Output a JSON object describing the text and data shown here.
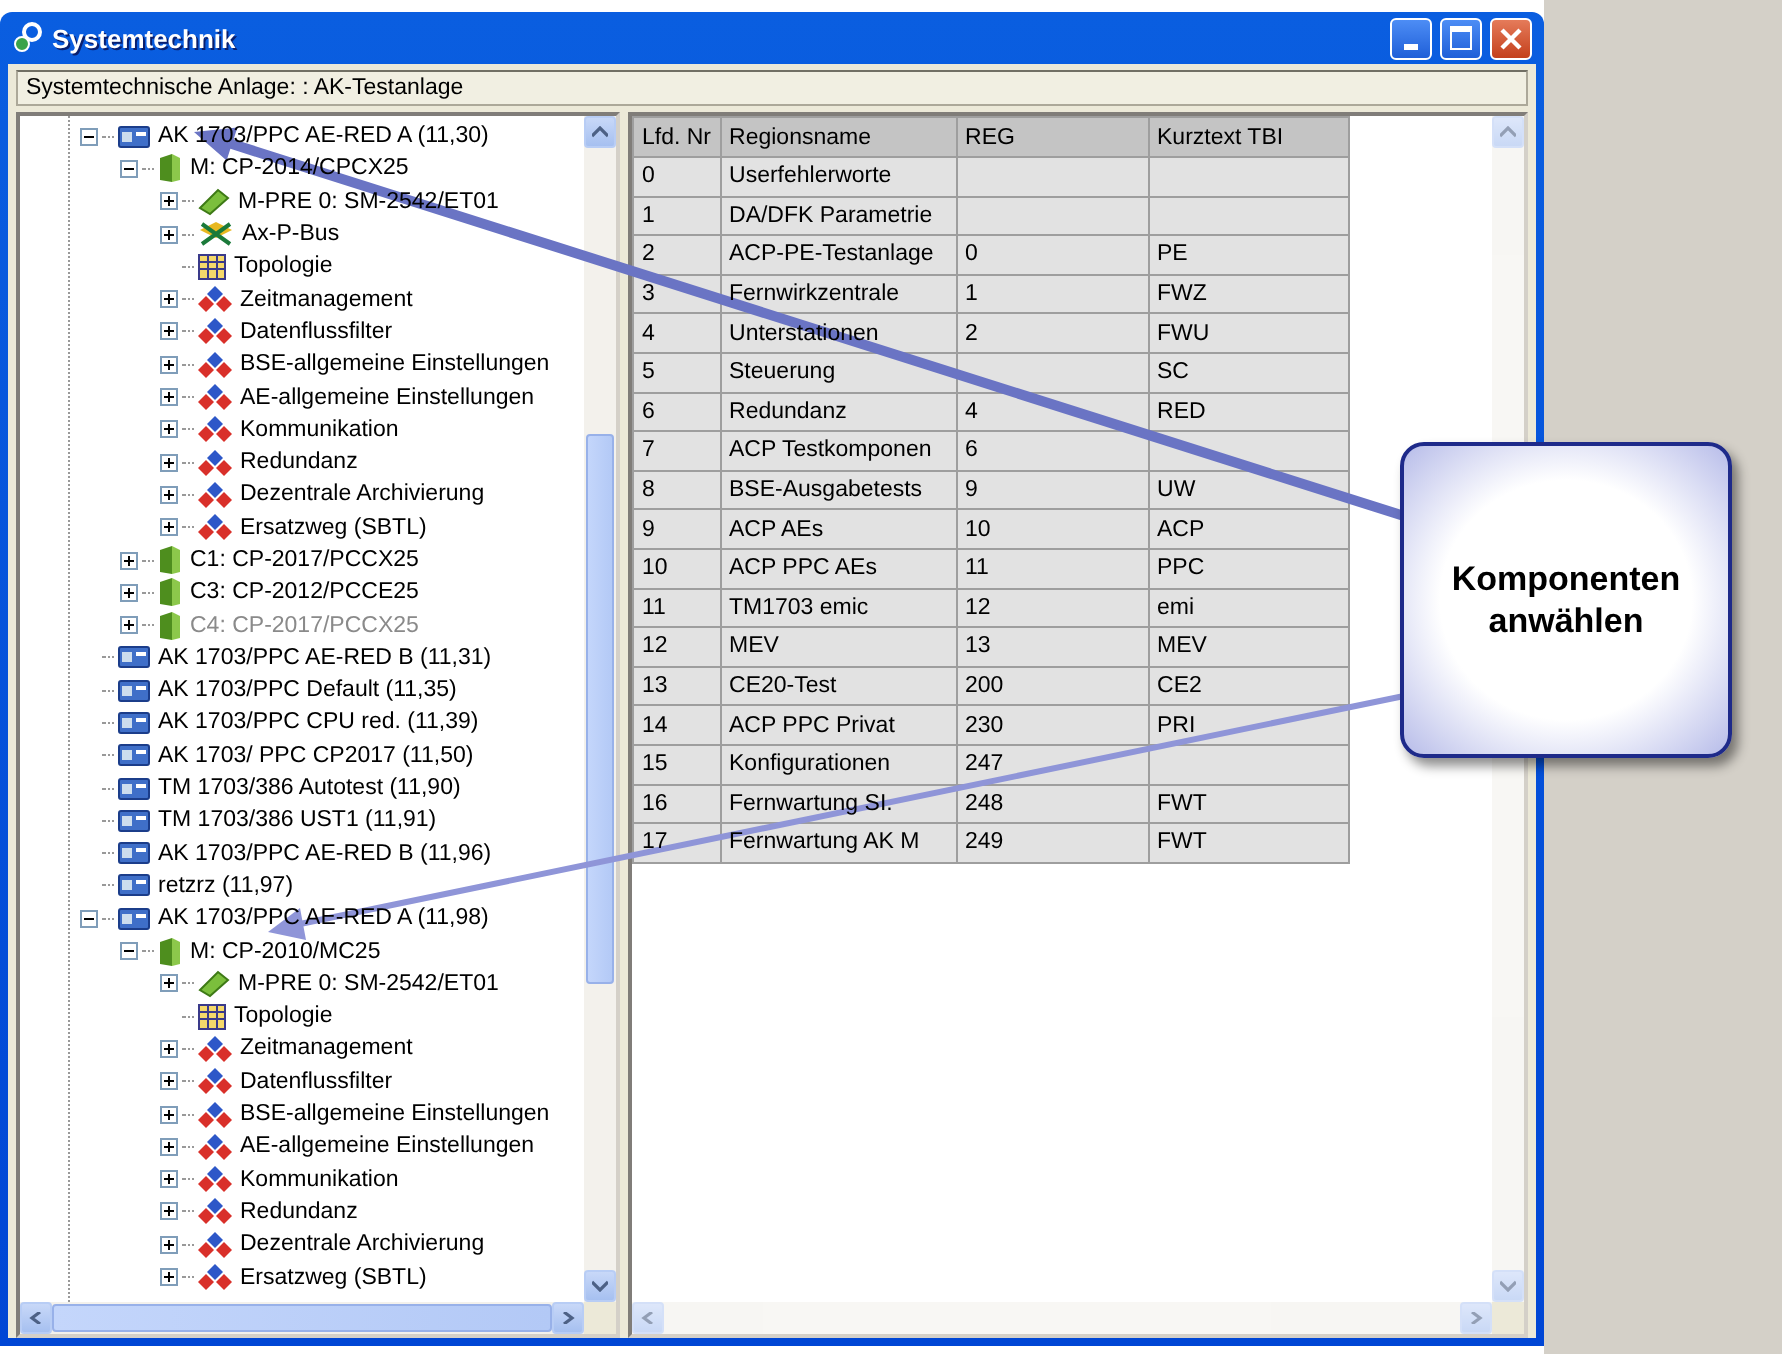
{
  "window": {
    "title": "Systemtechnik"
  },
  "address_bar": "Systemtechnische Anlage: : AK-Testanlage",
  "tree": [
    {
      "label": "AK 1703/PPC AE-RED A (11,30)",
      "kind": "station",
      "expanded": true,
      "children": [
        {
          "label": "M: CP-2014/CPCX25",
          "kind": "module",
          "expanded": true,
          "children": [
            {
              "label": "M-PRE 0: SM-2542/ET01",
              "kind": "chip",
              "expanded": false
            },
            {
              "label": "Ax-P-Bus",
              "kind": "bus",
              "expanded": false
            },
            {
              "label": "Topologie",
              "kind": "table"
            },
            {
              "label": "Zeitmanagement",
              "kind": "setting",
              "expanded": false
            },
            {
              "label": "Datenflussfilter",
              "kind": "setting",
              "expanded": false
            },
            {
              "label": "BSE-allgemeine Einstellungen",
              "kind": "setting",
              "expanded": false
            },
            {
              "label": "AE-allgemeine Einstellungen",
              "kind": "setting",
              "expanded": false
            },
            {
              "label": "Kommunikation",
              "kind": "setting",
              "expanded": false
            },
            {
              "label": "Redundanz",
              "kind": "setting",
              "expanded": false
            },
            {
              "label": "Dezentrale Archivierung",
              "kind": "setting",
              "expanded": false
            },
            {
              "label": "Ersatzweg (SBTL)",
              "kind": "setting",
              "expanded": false
            }
          ]
        },
        {
          "label": "C1: CP-2017/PCCX25",
          "kind": "module",
          "expanded": false
        },
        {
          "label": "C3: CP-2012/PCCE25",
          "kind": "module",
          "expanded": false
        },
        {
          "label": "C4: CP-2017/PCCX25",
          "kind": "module",
          "expanded": false,
          "disabled": true
        }
      ]
    },
    {
      "label": "AK 1703/PPC AE-RED B (11,31)",
      "kind": "station"
    },
    {
      "label": "AK 1703/PPC Default (11,35)",
      "kind": "station"
    },
    {
      "label": "AK 1703/PPC CPU red. (11,39)",
      "kind": "station"
    },
    {
      "label": "AK 1703/ PPC CP2017 (11,50)",
      "kind": "station"
    },
    {
      "label": "TM 1703/386 Autotest (11,90)",
      "kind": "station"
    },
    {
      "label": "TM 1703/386 UST1 (11,91)",
      "kind": "station"
    },
    {
      "label": "AK 1703/PPC AE-RED B (11,96)",
      "kind": "station"
    },
    {
      "label": "retzrz (11,97)",
      "kind": "station"
    },
    {
      "label": "AK 1703/PPC AE-RED A (11,98)",
      "kind": "station",
      "expanded": true,
      "children": [
        {
          "label": "M: CP-2010/MC25",
          "kind": "module",
          "expanded": true,
          "children": [
            {
              "label": "M-PRE 0: SM-2542/ET01",
              "kind": "chip",
              "expanded": false
            },
            {
              "label": "Topologie",
              "kind": "table"
            },
            {
              "label": "Zeitmanagement",
              "kind": "setting",
              "expanded": false
            },
            {
              "label": "Datenflussfilter",
              "kind": "setting",
              "expanded": false
            },
            {
              "label": "BSE-allgemeine Einstellungen",
              "kind": "setting",
              "expanded": false
            },
            {
              "label": "AE-allgemeine Einstellungen",
              "kind": "setting",
              "expanded": false
            },
            {
              "label": "Kommunikation",
              "kind": "setting",
              "expanded": false
            },
            {
              "label": "Redundanz",
              "kind": "setting",
              "expanded": false
            },
            {
              "label": "Dezentrale Archivierung",
              "kind": "setting",
              "expanded": false
            },
            {
              "label": "Ersatzweg (SBTL)",
              "kind": "setting",
              "expanded": false
            }
          ]
        }
      ]
    }
  ],
  "table": {
    "columns": [
      "Lfd. Nr",
      "Regionsname",
      "REG",
      "Kurztext TBI"
    ],
    "rows": [
      [
        "0",
        "Userfehlerworte",
        "",
        ""
      ],
      [
        "1",
        "DA/DFK Parametrie",
        "",
        ""
      ],
      [
        "2",
        "ACP-PE-Testanlage",
        "0",
        "PE"
      ],
      [
        "3",
        "Fernwirkzentrale",
        "1",
        "FWZ"
      ],
      [
        "4",
        "Unterstationen",
        "2",
        "FWU"
      ],
      [
        "5",
        "Steuerung",
        "",
        "SC"
      ],
      [
        "6",
        "Redundanz",
        "4",
        "RED"
      ],
      [
        "7",
        "ACP Testkomponen",
        "6",
        ""
      ],
      [
        "8",
        "BSE-Ausgabetests",
        "9",
        "UW"
      ],
      [
        "9",
        "ACP AEs",
        "10",
        "ACP"
      ],
      [
        "10",
        "ACP PPC AEs",
        "11",
        "PPC"
      ],
      [
        "11",
        "TM1703 emic",
        "12",
        "emi"
      ],
      [
        "12",
        "MEV",
        "13",
        "MEV"
      ],
      [
        "13",
        "CE20-Test",
        "200",
        "CE2"
      ],
      [
        "14",
        "ACP PPC Privat",
        "230",
        "PRI"
      ],
      [
        "15",
        "Konfigurationen",
        "247",
        ""
      ],
      [
        "16",
        "Fernwartung SI.",
        "248",
        "FWT"
      ],
      [
        "17",
        "Fernwartung AK M",
        "249",
        "FWT"
      ]
    ]
  },
  "callout": {
    "text": "Komponenten anwählen"
  }
}
